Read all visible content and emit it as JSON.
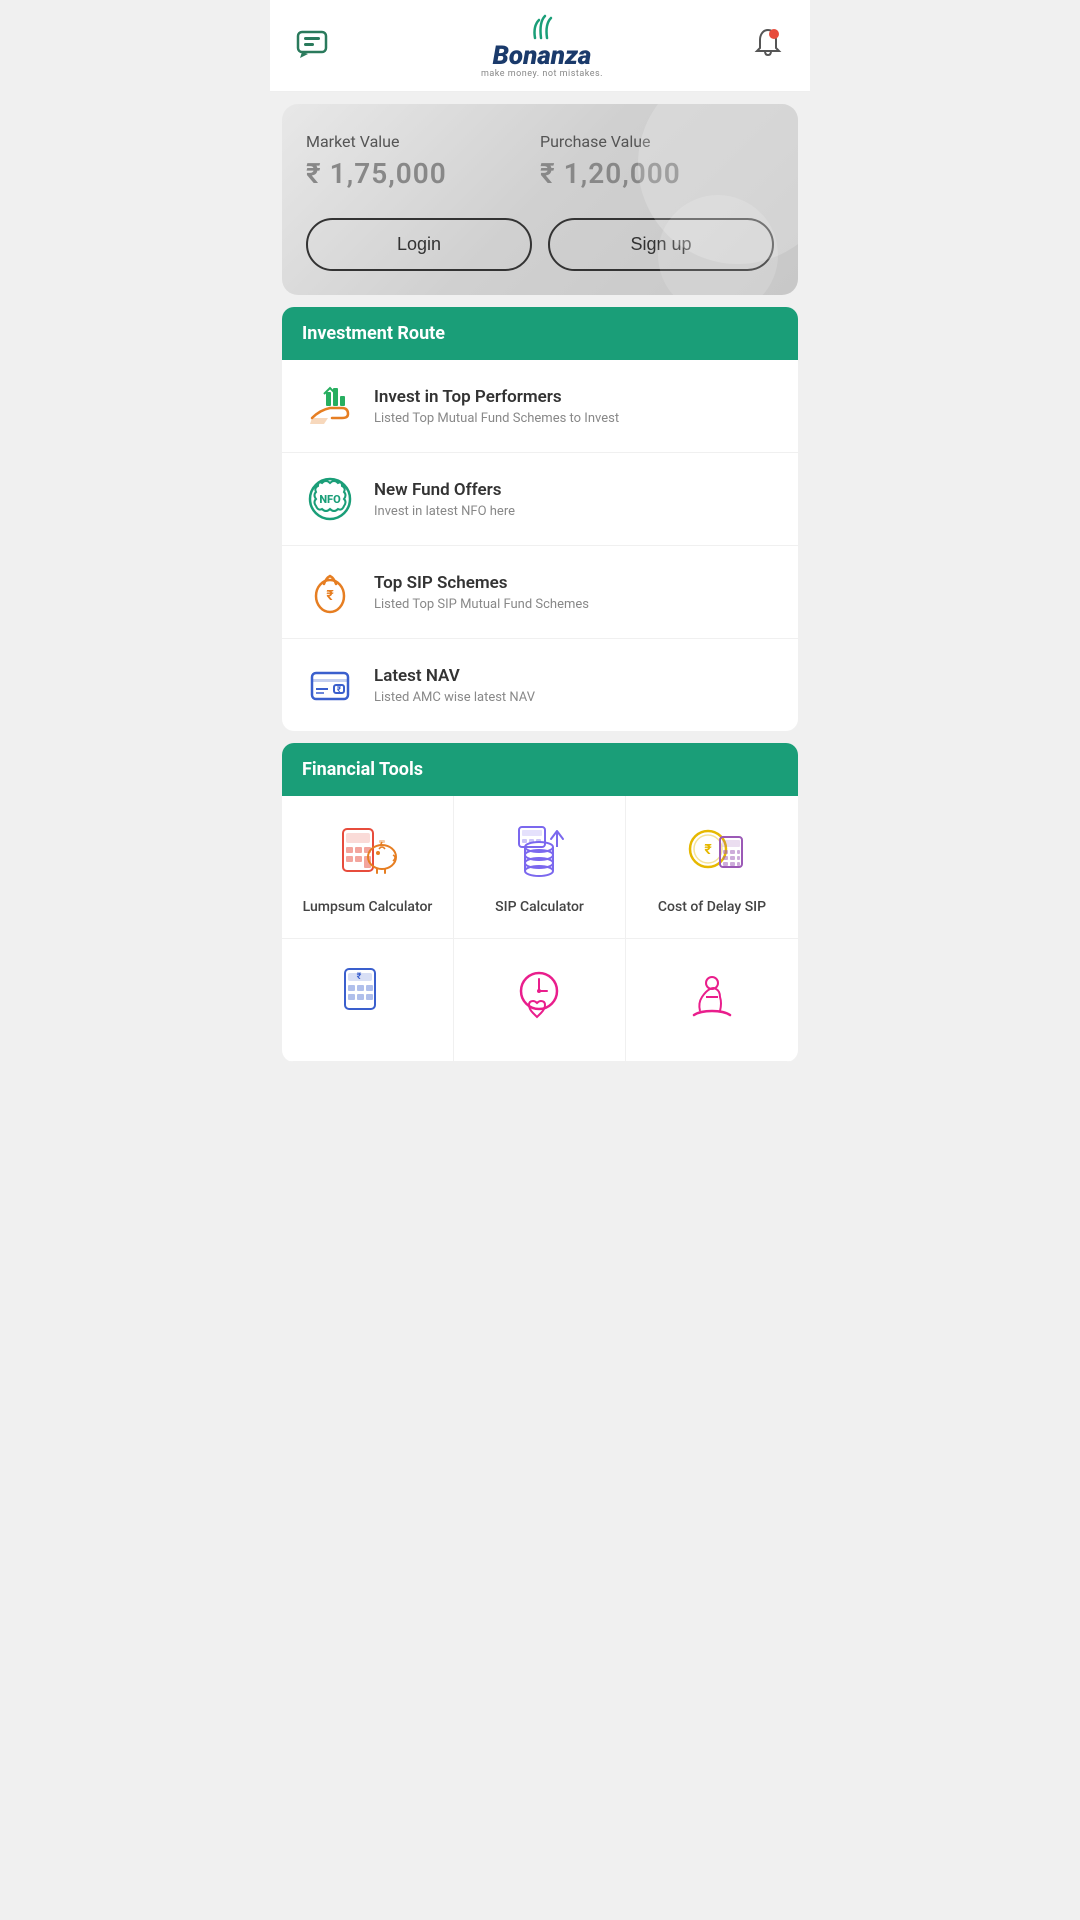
{
  "header": {
    "logo_name": "Bonanza",
    "logo_tagline": "make money. not mistakes.",
    "chat_icon": "💬",
    "bell_icon": "🔔"
  },
  "market_card": {
    "market_value_label": "Market Value",
    "market_value_amount": "₹ 1,75,000",
    "purchase_value_label": "Purchase Value",
    "purchase_value_amount": "₹ 1,20,000",
    "login_label": "Login",
    "signup_label": "Sign up"
  },
  "investment_route": {
    "section_title": "Investment Route",
    "items": [
      {
        "title": "Invest in Top Performers",
        "subtitle": "Listed Top Mutual Fund Schemes to Invest"
      },
      {
        "title": "New Fund Offers",
        "subtitle": "Invest in latest NFO here"
      },
      {
        "title": "Top SIP Schemes",
        "subtitle": "Listed Top SIP Mutual Fund Schemes"
      },
      {
        "title": "Latest NAV",
        "subtitle": "Listed AMC wise latest NAV"
      }
    ]
  },
  "financial_tools": {
    "section_title": "Financial Tools",
    "tools": [
      {
        "label": "Lumpsum Calculator"
      },
      {
        "label": "SIP Calculator"
      },
      {
        "label": "Cost of Delay SIP"
      },
      {
        "label": ""
      },
      {
        "label": ""
      },
      {
        "label": ""
      }
    ]
  }
}
